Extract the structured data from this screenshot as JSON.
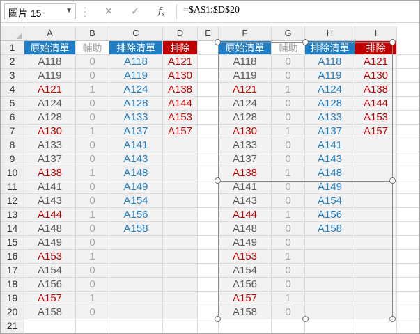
{
  "formula_bar": {
    "name_box": "圖片 15",
    "cancel_glyph": "✕",
    "enter_glyph": "✓",
    "fx_label": "f",
    "fx_sub": "x",
    "formula": "=$A$1:$D$20"
  },
  "columns": [
    "A",
    "B",
    "C",
    "D",
    "E",
    "F",
    "G",
    "H",
    "I"
  ],
  "rows": [
    "1",
    "2",
    "3",
    "4",
    "5",
    "6",
    "7",
    "8",
    "9",
    "10",
    "11",
    "12",
    "13",
    "14",
    "15",
    "16",
    "17",
    "18",
    "19",
    "20",
    "21"
  ],
  "headers": {
    "original_list": "原始清單",
    "helper": "輔助",
    "exclusion_list": "排除清單",
    "excluded": "排除"
  },
  "original_list": [
    "A118",
    "A119",
    "A121",
    "A124",
    "A128",
    "A130",
    "A133",
    "A137",
    "A138",
    "A141",
    "A143",
    "A144",
    "A148",
    "A149",
    "A153",
    "A154",
    "A156",
    "A157",
    "A158"
  ],
  "original_flag": [
    0,
    0,
    1,
    0,
    0,
    1,
    0,
    0,
    1,
    0,
    0,
    1,
    0,
    0,
    1,
    0,
    0,
    1,
    0
  ],
  "helper": [
    "0",
    "0",
    "1",
    "0",
    "0",
    "1",
    "0",
    "0",
    "1",
    "0",
    "0",
    "1",
    "0",
    "0",
    "1",
    "0",
    "0",
    "1",
    "0"
  ],
  "exclusion_list": [
    "A118",
    "A119",
    "A124",
    "A128",
    "A133",
    "A137",
    "A141",
    "A143",
    "A148",
    "A149",
    "A154",
    "A156",
    "A158"
  ],
  "excluded": [
    "A121",
    "A130",
    "A138",
    "A144",
    "A153",
    "A157"
  ],
  "colors": {
    "header_blue": "#1f7dc3",
    "header_red": "#c00000",
    "text_blue": "#1f7dc3",
    "text_red": "#c00000",
    "text_gray": "#595959",
    "helper_gray": "#a6a6a6",
    "band": "#f2f2f2"
  }
}
